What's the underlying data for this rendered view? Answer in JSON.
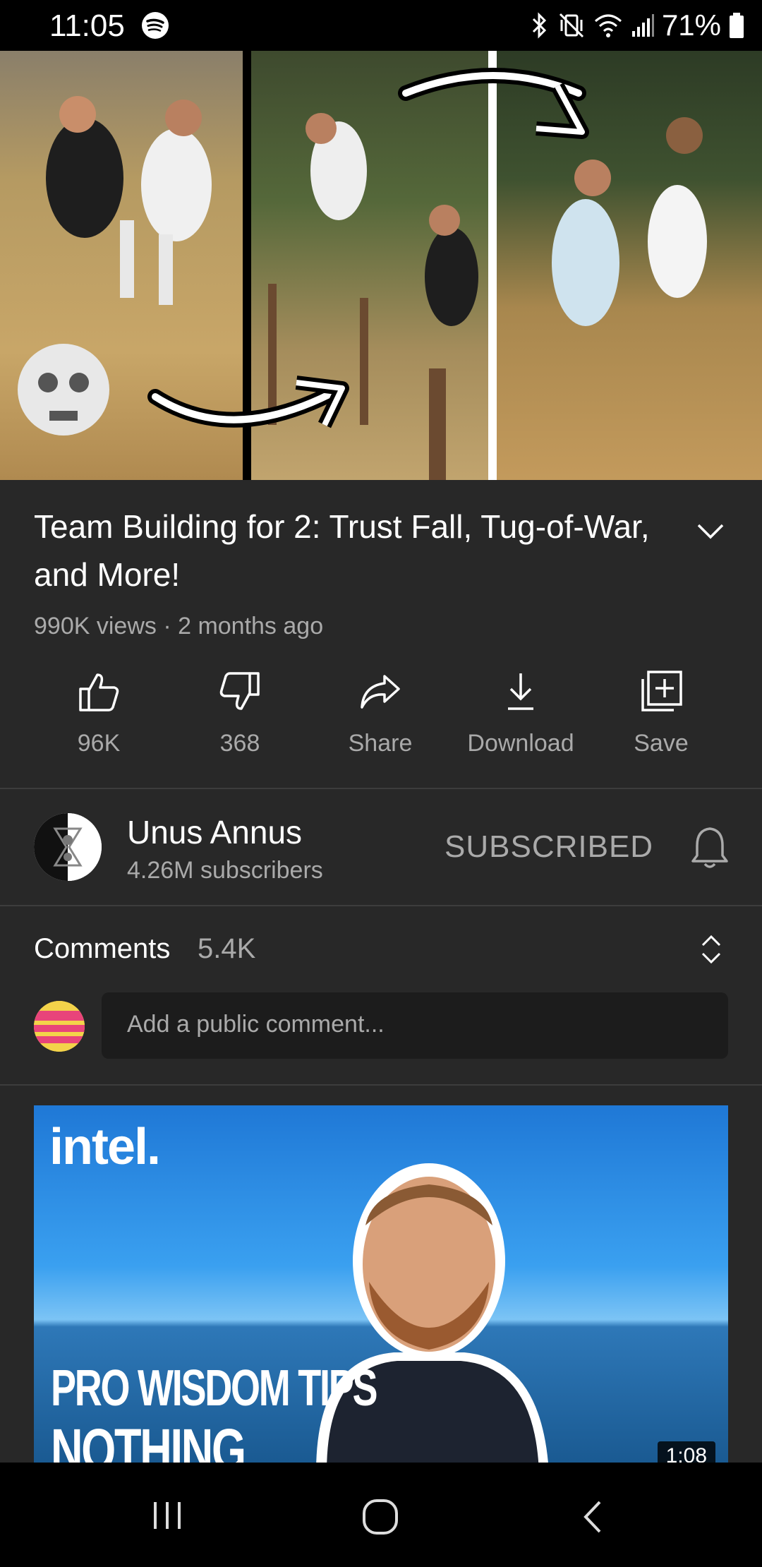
{
  "status_bar": {
    "time": "11:05",
    "battery_percent": "71%",
    "icons": [
      "spotify-icon",
      "bluetooth-icon",
      "vibrate-icon",
      "wifi-icon",
      "signal-icon",
      "battery-icon"
    ]
  },
  "video": {
    "title": "Team Building for 2: Trust Fall, Tug-of-War, and More!",
    "meta": "990K views · 2 months ago",
    "actions": [
      {
        "icon": "thumbs-up-icon",
        "label": "96K"
      },
      {
        "icon": "thumbs-down-icon",
        "label": "368"
      },
      {
        "icon": "share-icon",
        "label": "Share"
      },
      {
        "icon": "download-icon",
        "label": "Download"
      },
      {
        "icon": "save-icon",
        "label": "Save"
      }
    ]
  },
  "channel": {
    "name": "Unus Annus",
    "subscribers": "4.26M subscribers",
    "subscribe_state": "SUBSCRIBED"
  },
  "comments": {
    "title": "Comments",
    "count": "5.4K",
    "placeholder": "Add a public comment..."
  },
  "recommended": {
    "brand": "intel.",
    "text_line1": "PRO WISDOM TIPS",
    "text_line2": "NOTHING",
    "duration": "1:08"
  },
  "colors": {
    "background": "#282828",
    "secondary_text": "#aaaaaa",
    "separator": "#3d3d3d"
  }
}
